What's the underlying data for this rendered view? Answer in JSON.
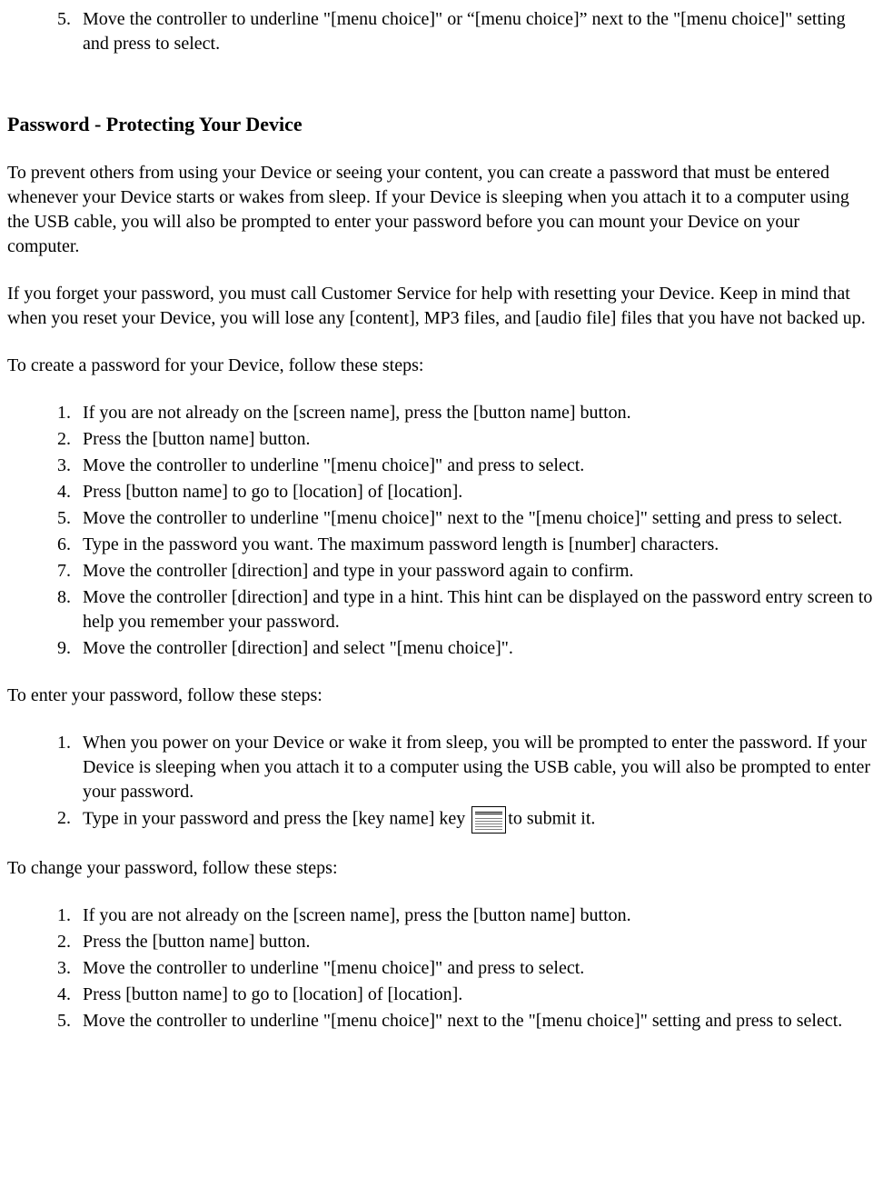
{
  "topList": {
    "start": 5,
    "items": [
      "Move the controller to underline \"[menu choice]\" or “[menu choice]” next to the \"[menu choice]\" setting and press to select."
    ]
  },
  "sectionHeading": "Password - Protecting Your Device",
  "intro1": "To prevent others from using your Device or seeing your content, you can create a password that must be entered whenever your Device starts or wakes from sleep. If your Device is sleeping when you attach it to a computer using the USB cable, you will also be prompted to enter your password before you can mount your Device on your computer.",
  "intro2": "If you forget your password, you must call Customer Service for help with resetting your Device. Keep in mind that when you reset your Device, you will lose any [content], MP3 files, and [audio file] files that you have not backed up.",
  "createIntro": "To create a password for your Device, follow these steps:",
  "createSteps": [
    "If you are not already on the [screen name], press the [button name] button.",
    "Press the [button name] button.",
    "Move the controller to underline \"[menu choice]\" and press to select.",
    "Press [button name] to go to [location] of [location].",
    "Move the controller to underline \"[menu choice]\" next to the \"[menu choice]\" setting and press to select.",
    "Type in the password you want. The maximum password length is [number] characters.",
    "Move the controller [direction] and type in your password again to confirm.",
    "Move the controller [direction] and type in a hint. This hint can be displayed on the password entry screen to help you remember your password.",
    "Move the controller [direction] and select \"[menu choice]\"."
  ],
  "enterIntro": "To enter your password, follow these steps:",
  "enterSteps": {
    "step1": "When you power on your Device or wake it from sleep, you will be prompted to enter the password. If your Device is sleeping when you attach it to a computer using the USB cable, you will also be prompted to enter your password.",
    "step2_before": "Type in your password and press the [key name] key ",
    "step2_after": "to submit it."
  },
  "changeIntro": "To change your password, follow these steps:",
  "changeSteps": [
    "If you are not already on the [screen name], press the [button name] button.",
    "Press the [button name] button.",
    "Move the controller to underline \"[menu choice]\" and press to select.",
    "Press [button name] to go to [location] of [location].",
    "Move the controller to underline \"[menu choice]\" next to the \"[menu choice]\" setting and press to select."
  ]
}
